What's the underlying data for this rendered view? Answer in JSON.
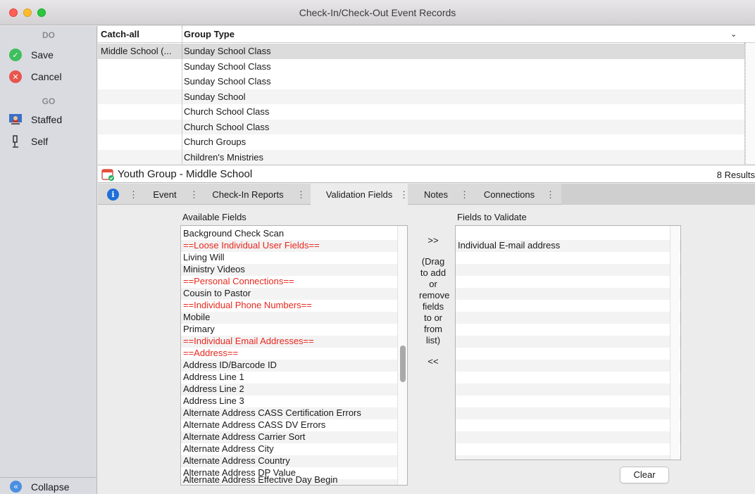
{
  "window": {
    "title": "Check-In/Check-Out Event Records"
  },
  "sidebar": {
    "do_heading": "DO",
    "go_heading": "GO",
    "save": "Save",
    "cancel": "Cancel",
    "staffed": "Staffed",
    "self": "Self",
    "collapse": "Collapse"
  },
  "grid": {
    "columns": [
      "Catch-all",
      "Group Type"
    ],
    "rows": [
      {
        "catch_all": "Middle School (...",
        "group_type": "Sunday School Class"
      },
      {
        "catch_all": "",
        "group_type": "Sunday School Class"
      },
      {
        "catch_all": "",
        "group_type": "Sunday School Class"
      },
      {
        "catch_all": "",
        "group_type": "Sunday School"
      },
      {
        "catch_all": "",
        "group_type": "Church School Class"
      },
      {
        "catch_all": "",
        "group_type": "Church School Class"
      },
      {
        "catch_all": "",
        "group_type": "Church Groups"
      },
      {
        "catch_all": "",
        "group_type": "Children's Mnistries"
      }
    ]
  },
  "record": {
    "title": "Youth Group - Middle School",
    "results": "8 Results"
  },
  "tabs": [
    "Event",
    "Check-In Reports",
    "Validation Fields",
    "Notes",
    "Connections"
  ],
  "validation": {
    "available_label": "Available Fields",
    "validate_label": "Fields to Validate",
    "available_fields": [
      {
        "text": "Background Check Scan",
        "red": false
      },
      {
        "text": "==Loose Individual User Fields==",
        "red": true
      },
      {
        "text": "Living Will",
        "red": false
      },
      {
        "text": "Ministry Videos",
        "red": false
      },
      {
        "text": "==Personal Connections==",
        "red": true
      },
      {
        "text": "Cousin to Pastor",
        "red": false
      },
      {
        "text": "==Individual Phone Numbers==",
        "red": true
      },
      {
        "text": "Mobile",
        "red": false
      },
      {
        "text": "Primary",
        "red": false
      },
      {
        "text": "==Individual Email Addresses==",
        "red": true
      },
      {
        "text": "==Address==",
        "red": true
      },
      {
        "text": "Address ID/Barcode ID",
        "red": false
      },
      {
        "text": "Address Line 1",
        "red": false
      },
      {
        "text": "Address Line 2",
        "red": false
      },
      {
        "text": "Address Line 3",
        "red": false
      },
      {
        "text": "Alternate Address CASS Certification Errors",
        "red": false
      },
      {
        "text": "Alternate Address CASS DV Errors",
        "red": false
      },
      {
        "text": "Alternate Address Carrier Sort",
        "red": false
      },
      {
        "text": "Alternate Address City",
        "red": false
      },
      {
        "text": "Alternate Address Country",
        "red": false
      },
      {
        "text": "Alternate Address DP Value",
        "red": false
      },
      {
        "text": "Alternate Address Effective Day Begin",
        "red": false
      }
    ],
    "fields_to_validate": [
      "Individual E-mail address"
    ],
    "add_arrow": ">>",
    "remove_arrow": "<<",
    "hint": [
      "(Drag",
      "to add",
      "or",
      "remove",
      "fields",
      "to or",
      "from",
      "list)"
    ],
    "clear": "Clear"
  },
  "colors": {
    "red_text": "#e8281e",
    "save_green": "#3fbf5e",
    "cancel_red": "#e8554d",
    "info_blue": "#1e6fd9"
  }
}
